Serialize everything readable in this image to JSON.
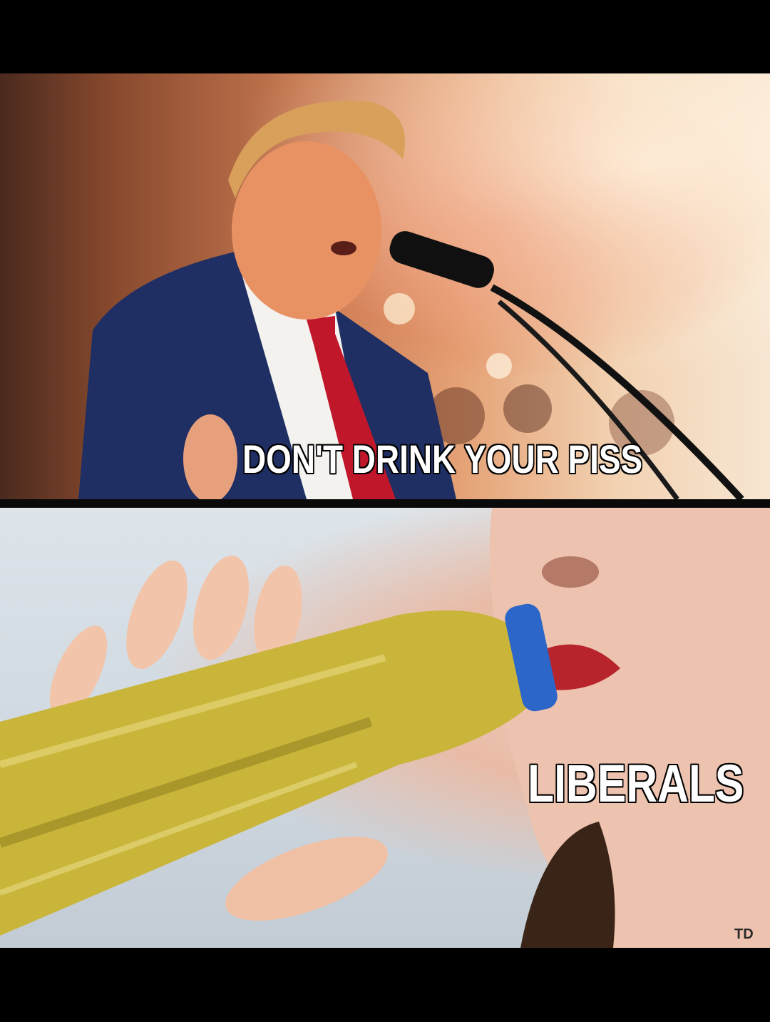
{
  "meme": {
    "top_caption": "DON'T DRINK YOUR PISS",
    "bottom_caption": "LIBERALS",
    "watermark": "TD"
  },
  "colors": {
    "frame": "#000000",
    "caption_fill": "#ffffff",
    "caption_outline": "#000000",
    "liquid": "#c9b53a"
  }
}
